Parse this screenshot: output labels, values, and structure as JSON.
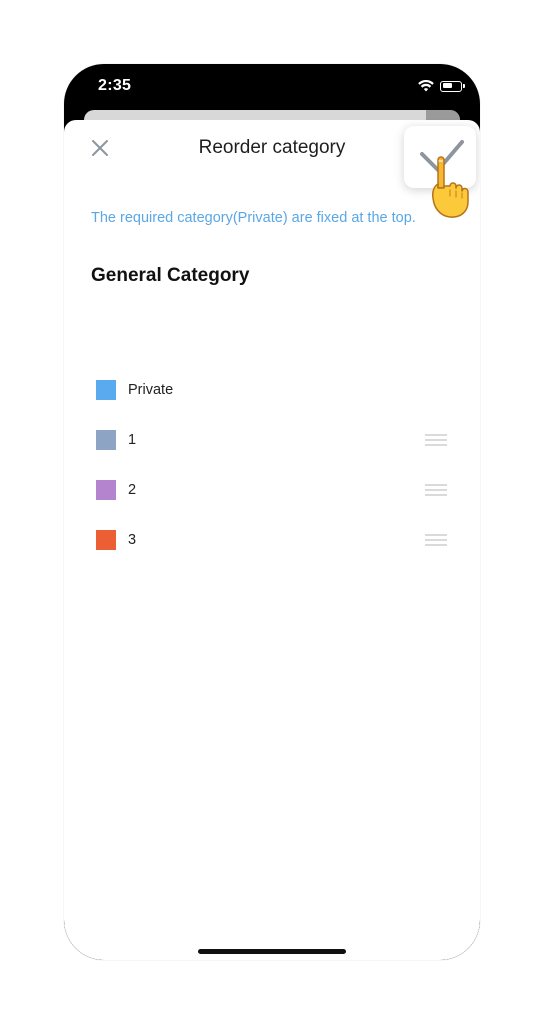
{
  "status_bar": {
    "time": "2:35",
    "icons": [
      "wifi-icon",
      "battery-icon"
    ]
  },
  "header": {
    "title": "Reorder category",
    "close_icon": "close-icon",
    "confirm_icon": "checkmark-icon"
  },
  "notice": "The required category(Private) are fixed at the top.",
  "section": {
    "title": "General Category"
  },
  "categories": [
    {
      "label": "Private",
      "color": "#5aaaf0",
      "draggable": false
    },
    {
      "label": "1",
      "color": "#8ea4c4",
      "draggable": true
    },
    {
      "label": "2",
      "color": "#b584cf",
      "draggable": true
    },
    {
      "label": "3",
      "color": "#ec5e34",
      "draggable": true
    }
  ],
  "colors": {
    "notice": "#5aa7e6",
    "drag_handle": "#c4c4c4",
    "confirm_check": "#8e959e"
  }
}
